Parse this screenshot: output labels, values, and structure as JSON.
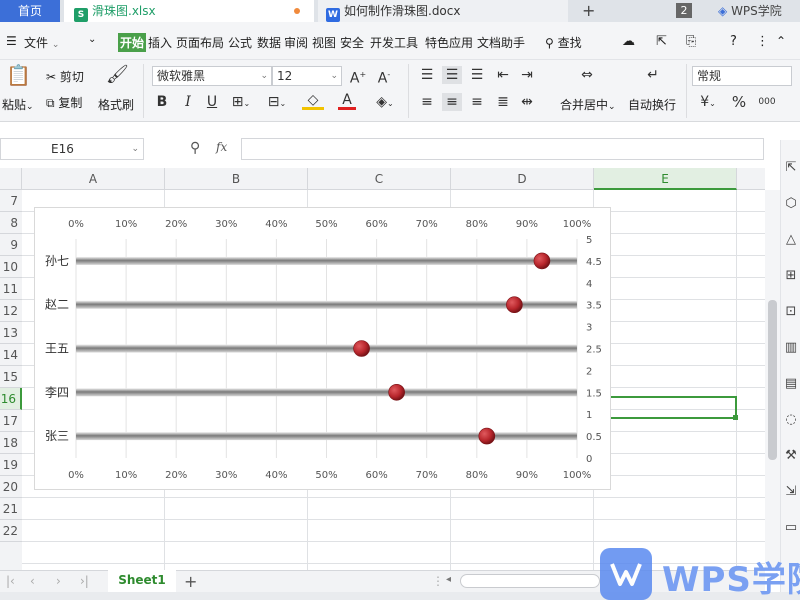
{
  "tabs": {
    "home": "首页",
    "xlsx": "滑珠图.xlsx",
    "docx": "如何制作滑珠图.docx",
    "count": "2",
    "account": "WPS学院"
  },
  "menu": {
    "file": "文件",
    "items": [
      "开始",
      "插入",
      "页面布局",
      "公式",
      "数据",
      "审阅",
      "视图",
      "安全",
      "开发工具",
      "特色应用",
      "文档助手"
    ],
    "search": "查找"
  },
  "ribbon": {
    "paste": "粘贴",
    "cut": "剪切",
    "copy": "复制",
    "format_painter": "格式刷",
    "font_name": "微软雅黑",
    "font_size": "12",
    "bold": "B",
    "italic": "I",
    "underline": "U",
    "merge": "合并居中",
    "wrap": "自动换行",
    "number_format": "常规",
    "percent": "%"
  },
  "formula_bar": {
    "cell_ref": "E16",
    "fx": "fx",
    "value": ""
  },
  "sheet": {
    "columns": [
      "A",
      "B",
      "C",
      "D",
      "E"
    ],
    "selected_column": "E",
    "rows": [
      "7",
      "8",
      "9",
      "10",
      "11",
      "12",
      "13",
      "14",
      "15",
      "16",
      "17",
      "18",
      "19",
      "20",
      "21",
      "22"
    ],
    "selected_row": "16",
    "tab": "Sheet1"
  },
  "chart_data": {
    "type": "scatter",
    "categories": [
      "张三",
      "李四",
      "王五",
      "赵二",
      "孙七"
    ],
    "series": [
      {
        "values": [
          0.82,
          0.64,
          0.57,
          0.875,
          0.93
        ]
      }
    ],
    "y_positions": [
      0.5,
      1.5,
      2.5,
      3.5,
      4.5
    ],
    "x_ticks": [
      "0%",
      "10%",
      "20%",
      "30%",
      "40%",
      "50%",
      "60%",
      "70%",
      "80%",
      "90%",
      "100%"
    ],
    "y_ticks": [
      "0",
      "0.5",
      "1",
      "1.5",
      "2",
      "2.5",
      "3",
      "3.5",
      "4",
      "4.5",
      "5"
    ],
    "xlim": [
      0,
      1
    ],
    "ylim": [
      0,
      5
    ],
    "grid": true,
    "colors": {
      "bead": "#b8262c",
      "track": "#8c8c8c",
      "grid": "#e3e3e3"
    }
  },
  "watermark": {
    "text": "WPS学院"
  }
}
